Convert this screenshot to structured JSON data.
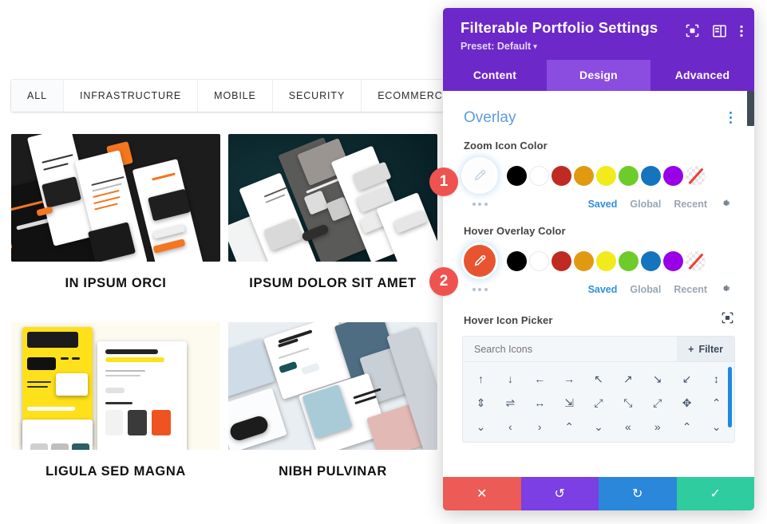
{
  "portfolio": {
    "filters": [
      {
        "label": "ALL",
        "active": true
      },
      {
        "label": "INFRASTRUCTURE",
        "active": false
      },
      {
        "label": "MOBILE",
        "active": false
      },
      {
        "label": "SECURITY",
        "active": false
      },
      {
        "label": "ECOMMERCE",
        "active": false
      }
    ],
    "items": [
      {
        "title": "IN IPSUM ORCI",
        "art": "dark-phone-mockups-orange-accent"
      },
      {
        "title": "IPSUM DOLOR SIT AMET",
        "art": "teal-ecommerce-phone-mockups"
      },
      {
        "title": "LIGULA SED MAGNA",
        "art": "yellow-white-web-page-mockups"
      },
      {
        "title": "NIBH PULVINAR",
        "art": "light-blue-sunglasses-shop-mockups"
      }
    ]
  },
  "modal": {
    "title": "Filterable Portfolio Settings",
    "preset_label": "Preset: Default",
    "header_icons": [
      "focus-target-icon",
      "panel-layout-icon",
      "kebab-menu-icon"
    ],
    "tabs": [
      {
        "label": "Content",
        "active": false
      },
      {
        "label": "Design",
        "active": true
      },
      {
        "label": "Advanced",
        "active": false
      }
    ],
    "section": {
      "title": "Overlay",
      "menu_icon": "vertical-dots-icon"
    },
    "fields": [
      {
        "label": "Zoom Icon Color",
        "badge": "1",
        "selected_color": "#ffffff",
        "selected_icon": "eyedropper-icon",
        "presets": [
          "#000000",
          "#ffffff",
          "#bf2a22",
          "#e09a12",
          "#f2ea1d",
          "#6dcb2a",
          "#1474bd",
          "#9900e8",
          "transparent"
        ],
        "source_tabs": [
          {
            "label": "Saved",
            "active": true
          },
          {
            "label": "Global",
            "active": false
          },
          {
            "label": "Recent",
            "active": false
          }
        ],
        "settings_icon": "gear-icon",
        "more_icon": "ellipsis-icon"
      },
      {
        "label": "Hover Overlay Color",
        "badge": "2",
        "selected_color": "#e8542f",
        "selected_icon": "eyedropper-icon",
        "presets": [
          "#000000",
          "#ffffff",
          "#bf2a22",
          "#e09a12",
          "#f2ea1d",
          "#6dcb2a",
          "#1474bd",
          "#9900e8",
          "transparent"
        ],
        "source_tabs": [
          {
            "label": "Saved",
            "active": true
          },
          {
            "label": "Global",
            "active": false
          },
          {
            "label": "Recent",
            "active": false
          }
        ],
        "settings_icon": "gear-icon",
        "more_icon": "ellipsis-icon"
      }
    ],
    "icon_picker": {
      "label": "Hover Icon Picker",
      "expand_icon": "focus-target-icon",
      "search_placeholder": "Search Icons",
      "search_value": "",
      "filter_button": "Filter",
      "filter_plus": "+",
      "icons": [
        "↑",
        "↓",
        "←",
        "→",
        "↖",
        "↗",
        "↘",
        "↙",
        "↕",
        "⇕",
        "⇌",
        "↔",
        "⇲",
        "⤢",
        "⤡",
        "⤢",
        "✥",
        "⌃",
        "⌄",
        "‹",
        "›",
        "⌃",
        "⌄",
        "«",
        "»",
        "⌃",
        "⌄"
      ]
    },
    "footer_buttons": [
      {
        "icon": "✕",
        "name": "cancel-button",
        "color": "#ec5b56"
      },
      {
        "icon": "↺",
        "name": "undo-button",
        "color": "#7b3fe4"
      },
      {
        "icon": "↻",
        "name": "redo-button",
        "color": "#2b87da"
      },
      {
        "icon": "✓",
        "name": "save-button",
        "color": "#2fcc9f"
      }
    ]
  }
}
